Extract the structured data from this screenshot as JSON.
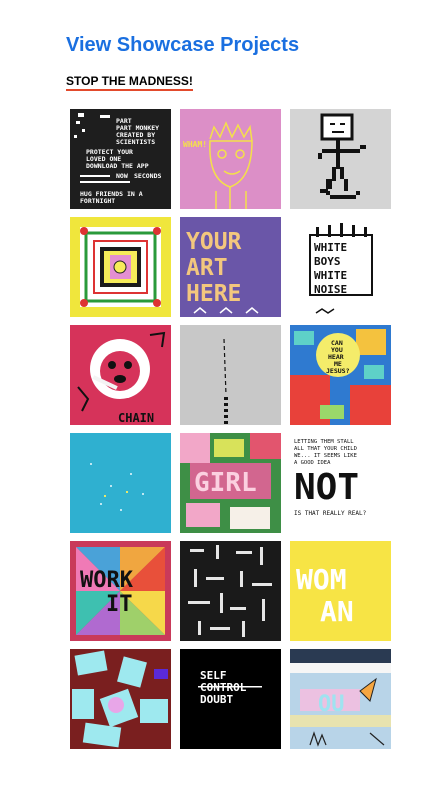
{
  "header": {
    "title": "View Showcase Projects",
    "subtitle": "STOP THE MADNESS!"
  },
  "projects": [
    {
      "name": "part-monkey",
      "bg": "#1e1e1e",
      "lines": [
        "PART",
        "PART MONKEY",
        "CREATED BY",
        "SCIENTISTS",
        "PROTECT YOUR",
        "LOVED ONE",
        "DOWNLOAD THE APP",
        "NOW",
        "SECONDS",
        "HUG FRIENDS IN A",
        "FORTNIGHT"
      ]
    },
    {
      "name": "pink-crown-face",
      "bg": "#dc8fc7",
      "lines": [
        "WHAM!"
      ]
    },
    {
      "name": "skateboard-stickman",
      "bg": "#d4d4d4",
      "lines": []
    },
    {
      "name": "yellow-frame",
      "bg": "#f0e63c",
      "lines": []
    },
    {
      "name": "your-art-here",
      "bg": "#6a56a8",
      "lines": [
        "YOUR",
        "ART",
        "HERE"
      ]
    },
    {
      "name": "white-boys-white-noise",
      "bg": "#ffffff",
      "lines": [
        "WHITE",
        "BOYS",
        "WHITE",
        "NOISE"
      ]
    },
    {
      "name": "chain-smoker",
      "bg": "#d6335a",
      "lines": [
        "CHAIN"
      ]
    },
    {
      "name": "grey-line",
      "bg": "#c8c8c8",
      "lines": []
    },
    {
      "name": "can-you-hear-me-jesus",
      "bg": "#2f7ad0",
      "lines": [
        "CAN",
        "YOU",
        "HEAR",
        "ME",
        "JESUS?"
      ]
    },
    {
      "name": "teal-sparkles",
      "bg": "#2fb0d0",
      "lines": []
    },
    {
      "name": "girl-collage",
      "bg": "#3e8f46",
      "lines": [
        "GIRL"
      ]
    },
    {
      "name": "not",
      "bg": "#ffffff",
      "lines": [
        "LETTING THEM STALL",
        "ALL THAT YOUR CHILD",
        "WE... IT SEEMS LIKE",
        "A GOOD IDEA",
        "NOT",
        "IS THAT REALLY REAL?"
      ]
    },
    {
      "name": "work-it",
      "bg": "#c93a5a",
      "lines": [
        "WORK",
        "IT"
      ]
    },
    {
      "name": "black-maze",
      "bg": "#1a1a1a",
      "lines": []
    },
    {
      "name": "woman",
      "bg": "#f7e445",
      "lines": [
        "WOM",
        "AN"
      ]
    },
    {
      "name": "cyan-shapes",
      "bg": "#7a1f1f",
      "lines": []
    },
    {
      "name": "self-control-doubt",
      "bg": "#000000",
      "lines": [
        "SELF",
        "CONTROL",
        "DOUBT"
      ]
    },
    {
      "name": "pastel-sea",
      "bg": "#b8d4e8",
      "lines": [
        "OU"
      ]
    }
  ]
}
